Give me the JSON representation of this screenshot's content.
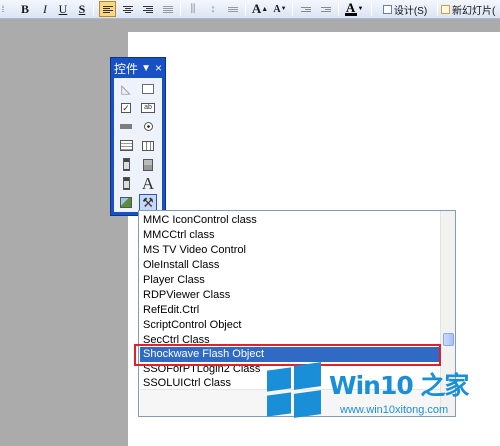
{
  "toolbar": {
    "bold": "B",
    "italic": "I",
    "underline": "U",
    "strikethrough": "S",
    "font_color": "A",
    "grow_font": "A",
    "shrink_font": "A",
    "design_label": "设计(S)",
    "new_slide_label": "新幻灯片(",
    "active_color": "#f9d783"
  },
  "toolbox": {
    "title": "控件",
    "menu_arrow": "▼",
    "close": "×",
    "label_tool": "A",
    "button_tool": "ab"
  },
  "dropdown": {
    "items": [
      "MMC IconControl class",
      "MMCCtrl class",
      "MS TV Video Control",
      "OleInstall Class",
      "Player Class",
      "RDPViewer Class",
      "RefEdit.Ctrl",
      "ScriptControl Object",
      "SecCtrl Class",
      "Shockwave Flash Object",
      "SSOForPTLogin2 Class",
      "SSOLUICtrl Class"
    ],
    "selected": "Shockwave Flash Object",
    "selection_color": "#316ac5",
    "highlight_color": "#e0202a"
  },
  "watermark": {
    "title": "Win10 之家",
    "url": "www.win10xitong.com",
    "color": "#1a8fd8"
  }
}
